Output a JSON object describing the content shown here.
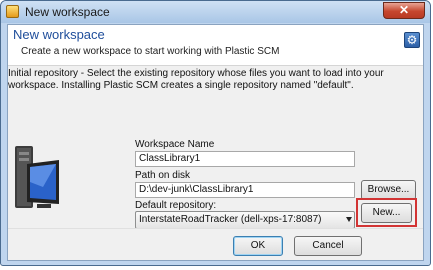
{
  "window": {
    "title": "New workspace",
    "close_glyph": "✕"
  },
  "header": {
    "title": "New workspace",
    "subtitle": "Create a new workspace to start working with Plastic SCM"
  },
  "info_text": "Initial repository - Select the existing repository whose files you want to load into your workspace. Installing Plastic SCM creates a single repository named \"default\".",
  "form": {
    "workspace_name_label": "Workspace Name",
    "workspace_name_value": "ClassLibrary1",
    "path_label": "Path on disk",
    "path_value": "D:\\dev-junk\\ClassLibrary1",
    "browse_label": "Browse...",
    "repository_label": "Default repository:",
    "repository_value": "InterstateRoadTracker (dell-xps-17:8087)",
    "new_label": "New..."
  },
  "footer": {
    "ok_label": "OK",
    "cancel_label": "Cancel"
  },
  "icons": [
    "app-icon",
    "close-icon",
    "gear-icon",
    "computer-icon",
    "chevron-down-icon"
  ],
  "colors": {
    "header_title": "#1f4e9b",
    "highlight_box": "#d23434",
    "titlebar": "#bfd5ee"
  }
}
